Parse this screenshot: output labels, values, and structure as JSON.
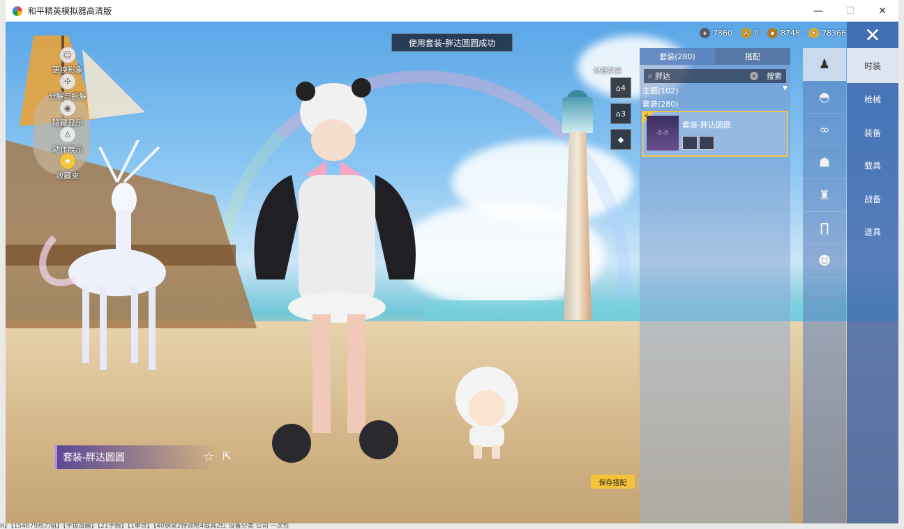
{
  "window": {
    "title": "和平精英模拟器高清版",
    "minimize": "—",
    "maximize": "☐",
    "close": "✕"
  },
  "left_menu": [
    {
      "label": "更换形象",
      "icon": "avatar-icon"
    },
    {
      "label": "分解与拆解",
      "icon": "split-icon"
    },
    {
      "label": "隐藏显示",
      "icon": "eye-icon"
    },
    {
      "label": "动作展示",
      "icon": "pose-icon"
    },
    {
      "label": "收藏夹",
      "icon": "star-icon"
    }
  ],
  "toast": "使用套装-胖达圆圆成功",
  "currency": [
    {
      "value": "7860",
      "color": "#5a5a6a"
    },
    {
      "value": "0",
      "color": "#c89a2a"
    },
    {
      "value": "8748",
      "color": "#b87a22"
    },
    {
      "value": "783663",
      "color": "#d9a93a"
    }
  ],
  "quick": {
    "label": "快捷换装",
    "slot_a": "4",
    "slot_b": "3"
  },
  "panel": {
    "tab_sets": "套装(280)",
    "tab_match": "搭配",
    "search_value": "胖达",
    "search_button": "搜索",
    "theme_row": "主题(102)",
    "set_row": "套装(280)",
    "item_name": "套装-胖达圆圆"
  },
  "side_tabs": [
    "时装",
    "枪械",
    "装备",
    "载具",
    "战备",
    "道具"
  ],
  "outfit_name": "套装-胖达圆圆",
  "save_button": "保存搭配",
  "bottom_strip": "R】【154679热力值】【手拔战趣】【21手腕】【1单世】【40钢梁2特效枪4载具2红       设备分类      公司      一次性"
}
